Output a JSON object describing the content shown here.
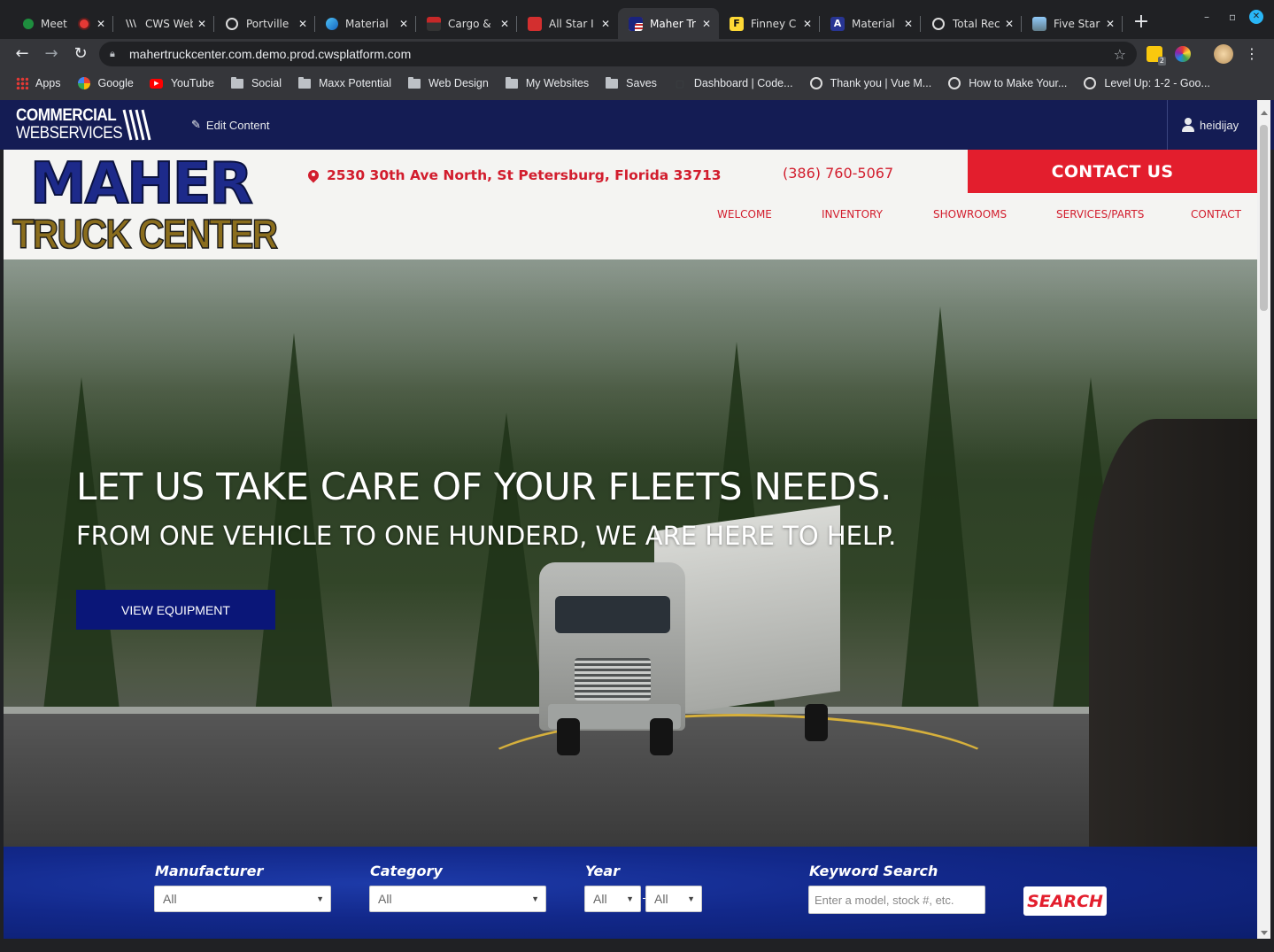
{
  "browser": {
    "tabs": [
      {
        "title": "Meet",
        "icon": "meet-icon"
      },
      {
        "title": "CWS Web",
        "icon": "cws-icon"
      },
      {
        "title": "Portville",
        "icon": "globe-icon"
      },
      {
        "title": "Material",
        "icon": "material-icon"
      },
      {
        "title": "Cargo &",
        "icon": "cargo-icon"
      },
      {
        "title": "All Star I",
        "icon": "allstar-icon"
      },
      {
        "title": "Maher Tr",
        "icon": "maher-flag-icon",
        "active": true
      },
      {
        "title": "Finney C",
        "icon": "finney-f-icon"
      },
      {
        "title": "Material",
        "icon": "material-icon"
      },
      {
        "title": "Total Rec",
        "icon": "globe-icon"
      },
      {
        "title": "Five Star",
        "icon": "fivestar-icon"
      }
    ],
    "url": "mahertruckcenter.com.demo.prod.cwsplatform.com",
    "extension_badge": "2",
    "bookmarks": [
      {
        "label": "Apps",
        "icon": "apps-grid-icon"
      },
      {
        "label": "Google",
        "icon": "google-icon"
      },
      {
        "label": "YouTube",
        "icon": "youtube-icon"
      },
      {
        "label": "Social",
        "icon": "folder-icon"
      },
      {
        "label": "Maxx Potential",
        "icon": "folder-icon"
      },
      {
        "label": "Web Design",
        "icon": "folder-icon"
      },
      {
        "label": "My Websites",
        "icon": "folder-icon"
      },
      {
        "label": "Saves",
        "icon": "folder-icon"
      },
      {
        "label": "Dashboard | Code...",
        "icon": "codepen-icon"
      },
      {
        "label": "Thank you | Vue M...",
        "icon": "globe-icon"
      },
      {
        "label": "How to Make Your...",
        "icon": "globe-icon"
      },
      {
        "label": "Level Up: 1-2 - Goo...",
        "icon": "globe-icon"
      }
    ]
  },
  "admin": {
    "logo_line1": "COMMERCIAL",
    "logo_line2": "WEBSERVICES",
    "edit_label": "Edit Content",
    "username": "heidijay"
  },
  "header": {
    "logo_top": "MAHER",
    "logo_bottom": "TRUCK CENTER",
    "address": "2530 30th Ave North, St Petersburg, Florida 33713",
    "phone": "(386) 760-5067",
    "contact_button": "CONTACT US",
    "nav": [
      "WELCOME",
      "INVENTORY",
      "SHOWROOMS",
      "SERVICES/PARTS",
      "CONTACT"
    ]
  },
  "hero": {
    "title": "LET US TAKE CARE OF YOUR FLEETS NEEDS.",
    "subtitle": "FROM ONE VEHICLE TO ONE HUNDERD, WE ARE HERE TO HELP.",
    "button": "VIEW EQUIPMENT"
  },
  "search": {
    "manufacturer_label": "Manufacturer",
    "manufacturer_value": "All",
    "category_label": "Category",
    "category_value": "All",
    "year_label": "Year",
    "year_from_value": "All",
    "year_to_value": "All",
    "keyword_label": "Keyword Search",
    "keyword_placeholder": "Enter a model, stock #, etc.",
    "button": "SEARCH"
  },
  "colors": {
    "brand_red": "#e31e2d",
    "brand_navy": "#141c54",
    "hero_button": "#0a1678"
  }
}
